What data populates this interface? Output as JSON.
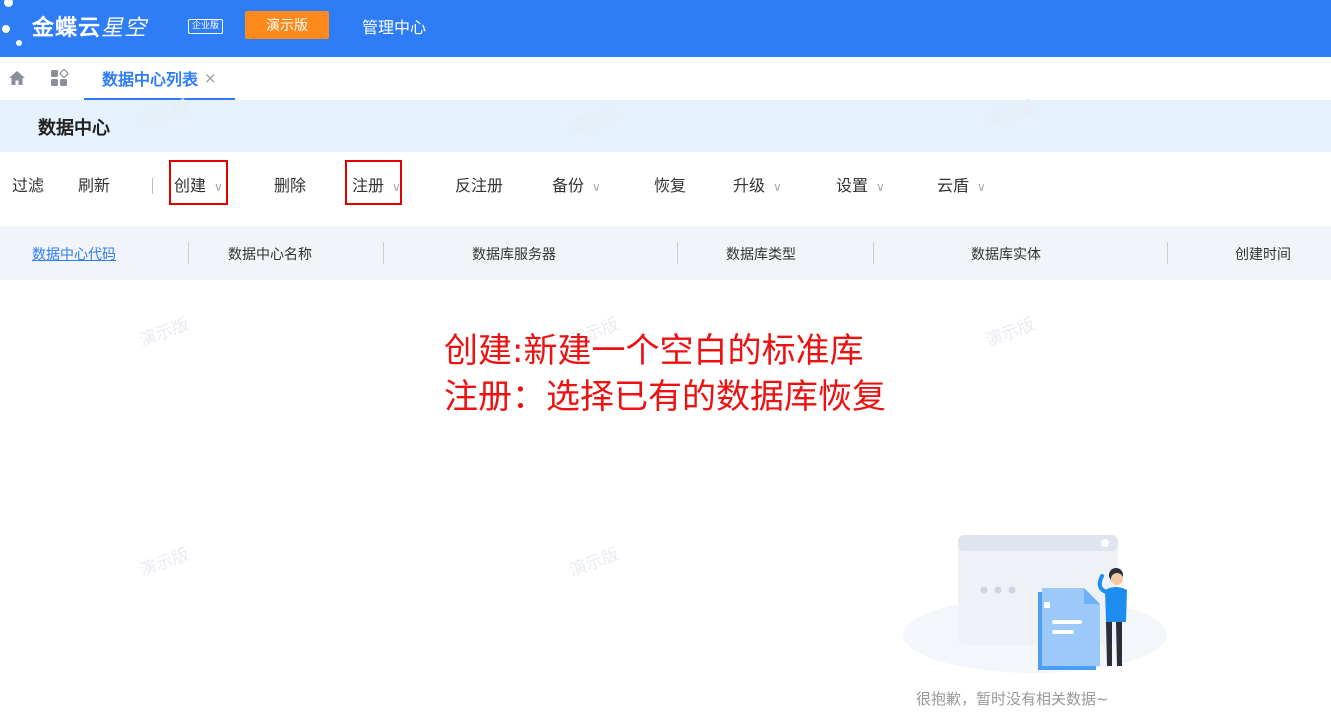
{
  "topbar": {
    "brand_main": "金蝶云",
    "brand_sub": "星空",
    "edition_badge": "企业版",
    "demo_badge": "演示版",
    "menu_item": "管理中心",
    "color": "#2e7cf6"
  },
  "tabs": [
    {
      "label": "数据中心列表",
      "close": "×",
      "active": true
    }
  ],
  "page": {
    "title": "数据中心"
  },
  "toolbar": {
    "filter": "过滤",
    "refresh": "刷新",
    "create": "创建",
    "delete": "删除",
    "register": "注册",
    "unregister": "反注册",
    "backup": "备份",
    "restore": "恢复",
    "upgrade": "升级",
    "settings": "设置",
    "cloud_shield": "云盾",
    "chevron": "∨"
  },
  "table": {
    "columns": [
      "数据中心代码",
      "数据中心名称",
      "数据库服务器",
      "数据库类型",
      "数据库实体",
      "创建时间"
    ]
  },
  "watermark": "演示版",
  "annotation": {
    "line1": "创建:新建一个空白的标准库",
    "line2": "注册：选择已有的数据库恢复",
    "color": "#ee1111"
  },
  "empty_state": {
    "message": "很抱歉，暂时没有相关数据~"
  }
}
